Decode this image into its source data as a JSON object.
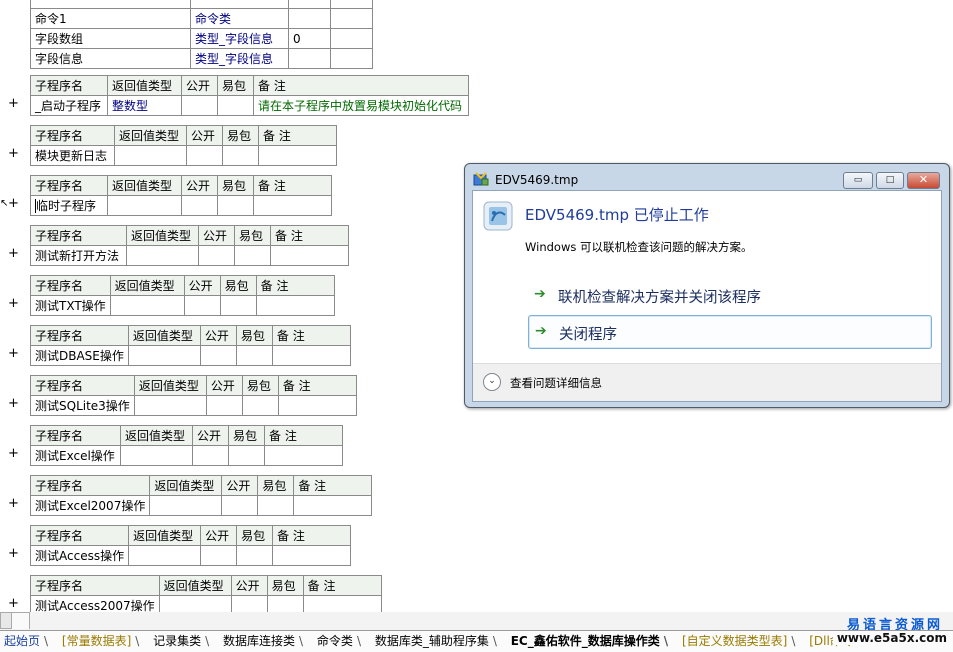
{
  "top_table": {
    "rows": [
      [
        "命令1",
        "命令类",
        "",
        ""
      ],
      [
        "字段数组",
        "类型_字段信息",
        "0",
        ""
      ],
      [
        "字段信息",
        "类型_字段信息",
        "",
        ""
      ]
    ]
  },
  "subprogram_headers": [
    "子程序名",
    "返回值类型",
    "公开",
    "易包",
    "备 注"
  ],
  "expand_symbol": "+",
  "subprograms": [
    {
      "name": "_启动子程序",
      "return_type": "整数型",
      "remark": "请在本子程序中放置易模块初始化代码"
    },
    {
      "name": "模块更新日志",
      "return_type": "",
      "remark": ""
    },
    {
      "name": "临时子程序",
      "return_type": "",
      "remark": ""
    },
    {
      "name": "测试新打开方法",
      "return_type": "",
      "remark": ""
    },
    {
      "name": "测试TXT操作",
      "return_type": "",
      "remark": ""
    },
    {
      "name": "测试DBASE操作",
      "return_type": "",
      "remark": ""
    },
    {
      "name": "测试SQLite3操作",
      "return_type": "",
      "remark": ""
    },
    {
      "name": "测试Excel操作",
      "return_type": "",
      "remark": ""
    },
    {
      "name": "测试Excel2007操作",
      "return_type": "",
      "remark": ""
    },
    {
      "name": "测试Access操作",
      "return_type": "",
      "remark": ""
    },
    {
      "name": "测试Access2007操作",
      "return_type": "",
      "remark": ""
    }
  ],
  "dialog": {
    "title": "EDV5469.tmp",
    "heading": "EDV5469.tmp 已停止工作",
    "subtext": "Windows 可以联机检查该问题的解决方案。",
    "option_online": "联机检查解决方案并关闭该程序",
    "option_close": "关闭程序",
    "footer": "查看问题详细信息",
    "minimize_glyph": "▭",
    "maximize_glyph": "□",
    "close_glyph": "✕",
    "arrow_glyph": "➔",
    "chevron_glyph": "⌄"
  },
  "tabs": [
    {
      "label": "起始页",
      "style": "blue"
    },
    {
      "label": "[常量数据表]",
      "style": "gold"
    },
    {
      "label": "记录集类",
      "style": "plain"
    },
    {
      "label": "数据库连接类",
      "style": "plain"
    },
    {
      "label": "命令类",
      "style": "plain"
    },
    {
      "label": "数据库类_辅助程序集",
      "style": "plain"
    },
    {
      "label": "EC_鑫佑软件_数据库操作类",
      "style": "bold"
    },
    {
      "label": "[自定义数据类型表]",
      "style": "gold"
    },
    {
      "label": "[Dll命令",
      "style": "gold"
    }
  ],
  "tab_separator": "\\",
  "watermark": {
    "text": "易语言资源网",
    "url": "www.e5a5x.com"
  },
  "colors": {
    "header_bg": "#eef3ee",
    "type_blue": "#00007f",
    "remark_green": "#006a00",
    "dialog_heading": "#1f3d99"
  }
}
